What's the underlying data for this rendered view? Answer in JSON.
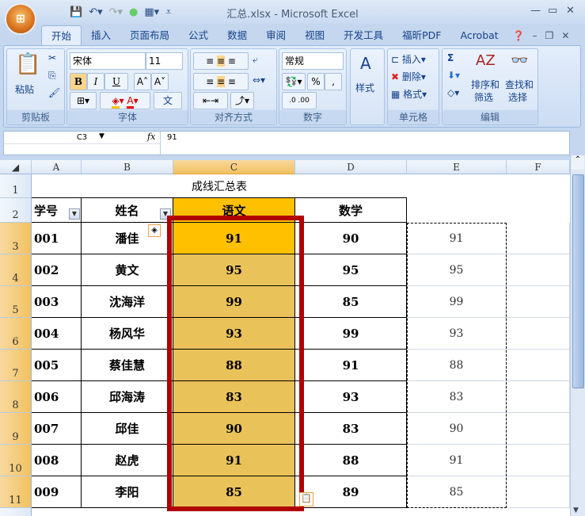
{
  "window": {
    "title": "汇总.xlsx - Microsoft Excel"
  },
  "tabs": [
    "开始",
    "插入",
    "页面布局",
    "公式",
    "数据",
    "审阅",
    "视图",
    "开发工具",
    "福昕PDF",
    "Acrobat"
  ],
  "ribbon": {
    "clipboard": {
      "label": "剪贴板",
      "paste": "粘贴"
    },
    "font": {
      "label": "字体",
      "name": "宋体",
      "size": "11",
      "bold": "B",
      "italic": "I",
      "underline": "U",
      "grow": "A˄",
      "shrink": "A˅",
      "phonetic": "文"
    },
    "alignment": {
      "label": "对齐方式"
    },
    "number": {
      "label": "数字",
      "format": "常规",
      "percent": "%",
      "comma": ","
    },
    "styles": {
      "label": "样式"
    },
    "cells": {
      "label": "单元格",
      "insert": "插入",
      "delete": "删除",
      "format": "格式"
    },
    "editing": {
      "label": "编辑",
      "sum": "Σ",
      "sort": "排序和\n筛选",
      "sort1": "排序和",
      "sort2": "筛选",
      "find1": "查找和",
      "find2": "选择"
    }
  },
  "formula_bar": {
    "name_box": "C3",
    "fx": "fx",
    "value": "91"
  },
  "columns": [
    "A",
    "B",
    "C",
    "D",
    "E",
    "F"
  ],
  "sheet": {
    "title": "成线汇总表",
    "headers": [
      "学号",
      "姓名",
      "语文",
      "数学"
    ],
    "rows": [
      {
        "id": "001",
        "name": "潘佳",
        "chinese": "91",
        "math": "90",
        "copy": "91"
      },
      {
        "id": "002",
        "name": "黄文",
        "chinese": "95",
        "math": "95",
        "copy": "95"
      },
      {
        "id": "003",
        "name": "沈海洋",
        "chinese": "99",
        "math": "85",
        "copy": "99"
      },
      {
        "id": "004",
        "name": "杨风华",
        "chinese": "93",
        "math": "99",
        "copy": "93"
      },
      {
        "id": "005",
        "name": "蔡佳慧",
        "chinese": "88",
        "math": "91",
        "copy": "88"
      },
      {
        "id": "006",
        "name": "邱海涛",
        "chinese": "83",
        "math": "93",
        "copy": "83"
      },
      {
        "id": "007",
        "name": "邱佳",
        "chinese": "90",
        "math": "83",
        "copy": "90"
      },
      {
        "id": "008",
        "name": "赵虎",
        "chinese": "91",
        "math": "88",
        "copy": "91"
      },
      {
        "id": "009",
        "name": "李阳",
        "chinese": "85",
        "math": "89",
        "copy": "85"
      }
    ]
  },
  "colors": {
    "selected_fill": "#e9c25a",
    "header_fill": "#ffc000",
    "highlight_box": "#b00000"
  }
}
